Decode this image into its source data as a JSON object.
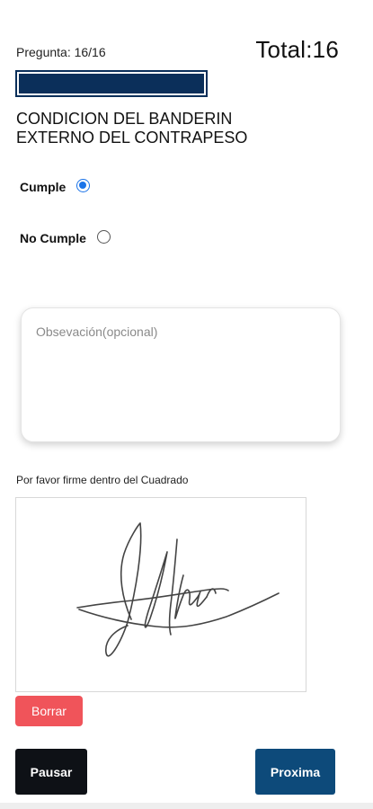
{
  "header": {
    "question_counter": "Pregunta: 16/16",
    "total": "Total:16",
    "progress_fraction": 1.0
  },
  "question": {
    "title": "CONDICION DEL BANDERIN\nEXTERNO DEL CONTRAPESO"
  },
  "options": [
    {
      "label": "Cumple",
      "selected": true
    },
    {
      "label": "No Cumple",
      "selected": false
    }
  ],
  "observation": {
    "placeholder": "Obsevación(opcional)",
    "value": ""
  },
  "signature": {
    "instructions": "Por favor firme dentro del Cuadrado",
    "stroke_color": "#444444"
  },
  "buttons": {
    "clear_label": "Borrar",
    "pause_label": "Pausar",
    "next_label": "Proxima"
  },
  "colors": {
    "progress": "#0b2f5a",
    "radio_selected": "#1a73e8",
    "clear_button": "#f0545a",
    "pause_button": "#0e1116",
    "next_button": "#0d4a7a"
  }
}
